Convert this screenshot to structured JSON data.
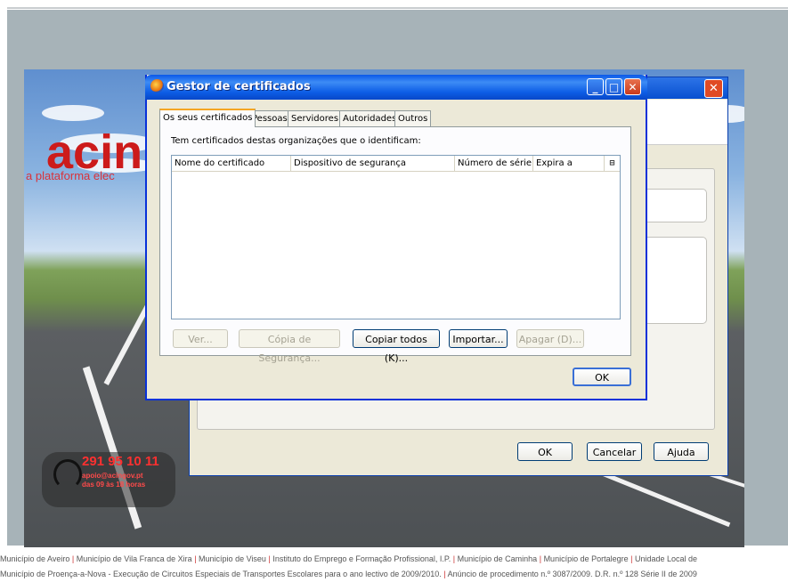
{
  "background": {
    "logo_text": "acin",
    "logo_subtitle": "a plataforma elec",
    "phone": "291 95 10 11",
    "email": "apoio@acingov.pt",
    "hours": "das 09 às 18 horas"
  },
  "back_dialog": {
    "close_glyph": "✕",
    "ok_label": "OK",
    "cancel_label": "Cancelar",
    "help_label": "Ajuda"
  },
  "dialog": {
    "title": "Gestor de certificados",
    "minimize_glyph": "_",
    "maximize_glyph": "□",
    "close_glyph": "✕",
    "tabs": [
      {
        "label": "Os seus certificados",
        "active": true
      },
      {
        "label": "Pessoas",
        "active": false
      },
      {
        "label": "Servidores",
        "active": false
      },
      {
        "label": "Autoridades",
        "active": false
      },
      {
        "label": "Outros",
        "active": false
      }
    ],
    "description": "Tem certificados destas organizações que o identificam:",
    "columns": [
      "Nome do certificado",
      "Dispositivo de segurança",
      "Número de série",
      "Expira a"
    ],
    "column_picker_glyph": "⊟",
    "buttons": {
      "view": "Ver...",
      "backup": "Cópia de Segurança...",
      "backup_all": "Copiar todos (K)...",
      "import": "Importar...",
      "delete": "Apagar (D)..."
    },
    "ok_label": "OK"
  },
  "footer": {
    "line1": [
      "Município de Aveiro",
      "Município de Vila Franca de Xira",
      "Município de Viseu",
      "Instituto do Emprego e Formação Profissional, I.P.",
      "Município de Caminha",
      "Município de Portalegre",
      "Unidade Local de"
    ],
    "line2": [
      "Município de Proença-a-Nova - Execução de Circuitos Especiais de Transportes Escolares para o ano lectivo de 2009/2010.",
      "Anúncio de procedimento n.º 3087/2009. D.R. n.º 128 Série II de 2009"
    ]
  }
}
